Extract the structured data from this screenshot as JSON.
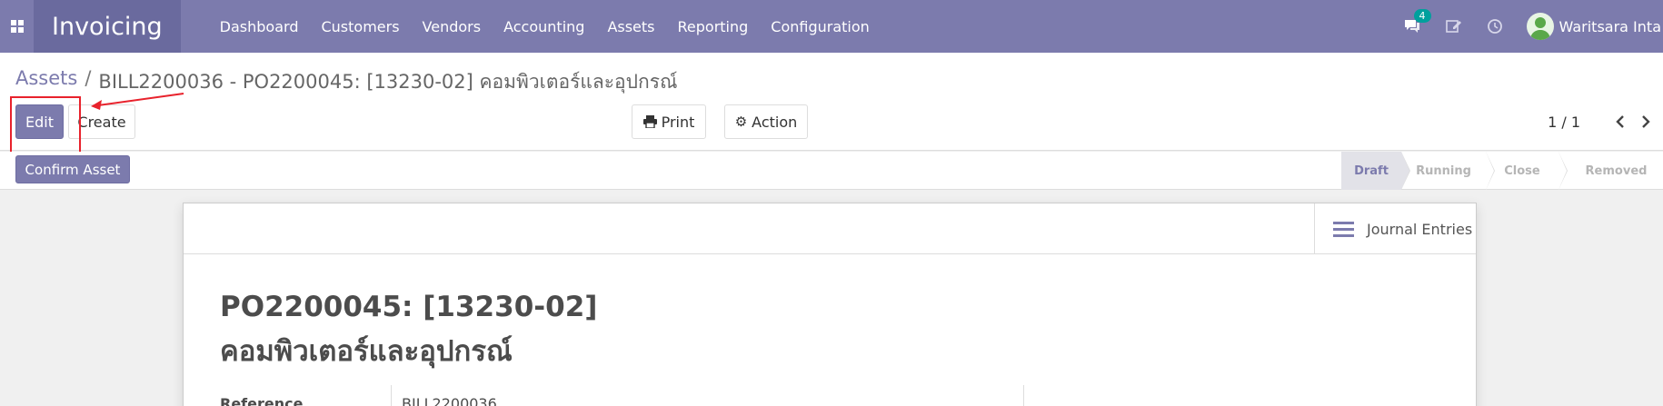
{
  "navbar": {
    "app_name": "Invoicing",
    "menu": [
      "Dashboard",
      "Customers",
      "Vendors",
      "Accounting",
      "Assets",
      "Reporting",
      "Configuration"
    ],
    "messages_count": "4",
    "user_name": "Waritsara Inta",
    "bg_color": "#7c7bad"
  },
  "breadcrumb": {
    "parent": "Assets",
    "separator": "/",
    "current": "BILL2200036 - PO2200045: [13230-02] คอมพิวเตอร์และอุปกรณ์"
  },
  "buttons": {
    "edit": "Edit",
    "create": "Create",
    "print": "Print",
    "action": "Action",
    "confirm": "Confirm Asset"
  },
  "pager": {
    "value": "1 / 1"
  },
  "stages": [
    "Draft",
    "Running",
    "Close",
    "Removed"
  ],
  "active_stage": "Draft",
  "sheet": {
    "journal_entries_label": "Journal Entries",
    "title_line1": "PO2200045: [13230-02]",
    "title_line2": "คอมพิวเตอร์และอุปกรณ์",
    "fields": [
      {
        "label": "Reference",
        "value": "BILL2200036"
      }
    ]
  },
  "icons": [
    "apps-icon",
    "chat-icon",
    "edit-note-icon",
    "clock-icon",
    "user-avatar-icon",
    "print-icon",
    "gear-icon",
    "chevron-left-icon",
    "chevron-right-icon",
    "list-icon"
  ]
}
